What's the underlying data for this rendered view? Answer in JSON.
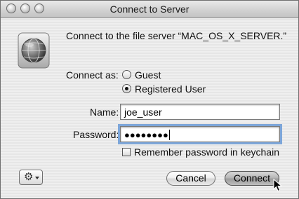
{
  "window": {
    "title": "Connect to Server"
  },
  "message": "Connect to the file server “MAC_OS_X_SERVER.”",
  "connect_as": {
    "label": "Connect as:",
    "options": [
      {
        "label": "Guest",
        "selected": false
      },
      {
        "label": "Registered User",
        "selected": true
      }
    ]
  },
  "name": {
    "label": "Name:",
    "value": "joe_user"
  },
  "password": {
    "label": "Password:",
    "masked_value": "●●●●●●●●"
  },
  "remember": {
    "label": "Remember password in keychain",
    "checked": false
  },
  "buttons": {
    "cancel": "Cancel",
    "connect": "Connect"
  },
  "icons": {
    "server": "network-globe-icon",
    "action": "gear-icon",
    "pointer": "arrow-cursor-icon"
  }
}
